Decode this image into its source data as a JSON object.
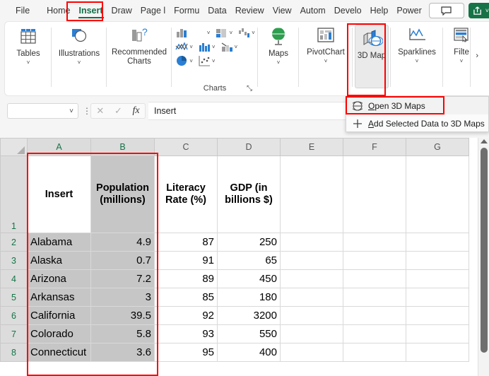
{
  "tabs": [
    {
      "label": "File",
      "active": false
    },
    {
      "label": "Home",
      "active": false
    },
    {
      "label": "Insert",
      "active": true
    },
    {
      "label": "Draw",
      "active": false
    },
    {
      "label": "Page l",
      "active": false
    },
    {
      "label": "Formu",
      "active": false
    },
    {
      "label": "Data",
      "active": false
    },
    {
      "label": "Review",
      "active": false
    },
    {
      "label": "View",
      "active": false
    },
    {
      "label": "Autom",
      "active": false
    },
    {
      "label": "Develo",
      "active": false
    },
    {
      "label": "Help",
      "active": false
    },
    {
      "label": "Power",
      "active": false
    }
  ],
  "topright": {
    "comments_icon": "comment-icon",
    "share_label": "share-icon",
    "share_chevron": "˅"
  },
  "ribbon": {
    "groups": [
      {
        "name": "tables",
        "label": "Tables",
        "icon": "table-icon",
        "chevron": "˅"
      },
      {
        "name": "illustrations",
        "label": "Illustrations",
        "icon": "illustrations-icon",
        "chevron": "˅"
      },
      {
        "name": "recommended-charts",
        "label": "Recommended Charts",
        "icon": "recommended-charts-icon"
      },
      {
        "name": "charts",
        "label": "Charts",
        "dialog_launcher": "⤡"
      },
      {
        "name": "maps",
        "label": "Maps",
        "icon": "globe-icon",
        "chevron": "˅"
      },
      {
        "name": "pivotchart",
        "label": "PivotChart",
        "icon": "pivotchart-icon",
        "chevron": "˅"
      },
      {
        "name": "3d-map",
        "label": "3D Map",
        "icon": "3d-map-icon",
        "chevron": "˅"
      },
      {
        "name": "sparklines",
        "label": "Sparklines",
        "icon": "sparklines-icon",
        "chevron": "˅"
      },
      {
        "name": "filters",
        "label": "Filte",
        "icon": "slicer-icon",
        "chevron": "˅",
        "overflow": "›"
      }
    ]
  },
  "dropdown": {
    "items": [
      {
        "label": "Open 3D Maps",
        "underline": "O",
        "rest": "pen 3D Maps",
        "icon": "globe-icon",
        "highlighted": true
      },
      {
        "label": "Add Selected Data to 3D Maps",
        "underline": "A",
        "rest": "dd Selected Data to 3D Maps",
        "icon": "plus-icon",
        "highlighted": false
      }
    ]
  },
  "formula_bar": {
    "name_box_value": "",
    "name_box_chevron": "˅",
    "more_icon": "⋮",
    "cancel_icon": "✕",
    "confirm_icon": "✓",
    "fx_icon": "fx",
    "formula_value": "Insert"
  },
  "grid": {
    "columns": [
      "A",
      "B",
      "C",
      "D",
      "E",
      "F",
      "G"
    ],
    "selected_columns": [
      "A",
      "B"
    ],
    "rows": [
      "1",
      "2",
      "3",
      "4",
      "5",
      "6",
      "7",
      "8"
    ],
    "header_row": [
      "Insert",
      "Population (millions)",
      "Literacy Rate (%)",
      "GDP (in billions $)",
      "",
      "",
      ""
    ],
    "data": [
      {
        "row": "2",
        "cells": [
          "Alabama",
          "4.9",
          "87",
          "250",
          "",
          "",
          ""
        ]
      },
      {
        "row": "3",
        "cells": [
          "Alaska",
          "0.7",
          "91",
          "65",
          "",
          "",
          ""
        ]
      },
      {
        "row": "4",
        "cells": [
          "Arizona",
          "7.2",
          "89",
          "450",
          "",
          "",
          ""
        ]
      },
      {
        "row": "5",
        "cells": [
          "Arkansas",
          "3",
          "85",
          "180",
          "",
          "",
          ""
        ]
      },
      {
        "row": "6",
        "cells": [
          "California",
          "39.5",
          "92",
          "3200",
          "",
          "",
          ""
        ]
      },
      {
        "row": "7",
        "cells": [
          "Colorado",
          "5.8",
          "93",
          "550",
          "",
          "",
          ""
        ]
      },
      {
        "row": "8",
        "cells": [
          "Connecticut",
          "3.6",
          "95",
          "400",
          "",
          "",
          ""
        ]
      }
    ]
  },
  "colors": {
    "accent_green": "#157347",
    "highlight_red": "#ff0000",
    "selection_gray": "#c6c6c6",
    "header_gray": "#e4e4e4"
  }
}
